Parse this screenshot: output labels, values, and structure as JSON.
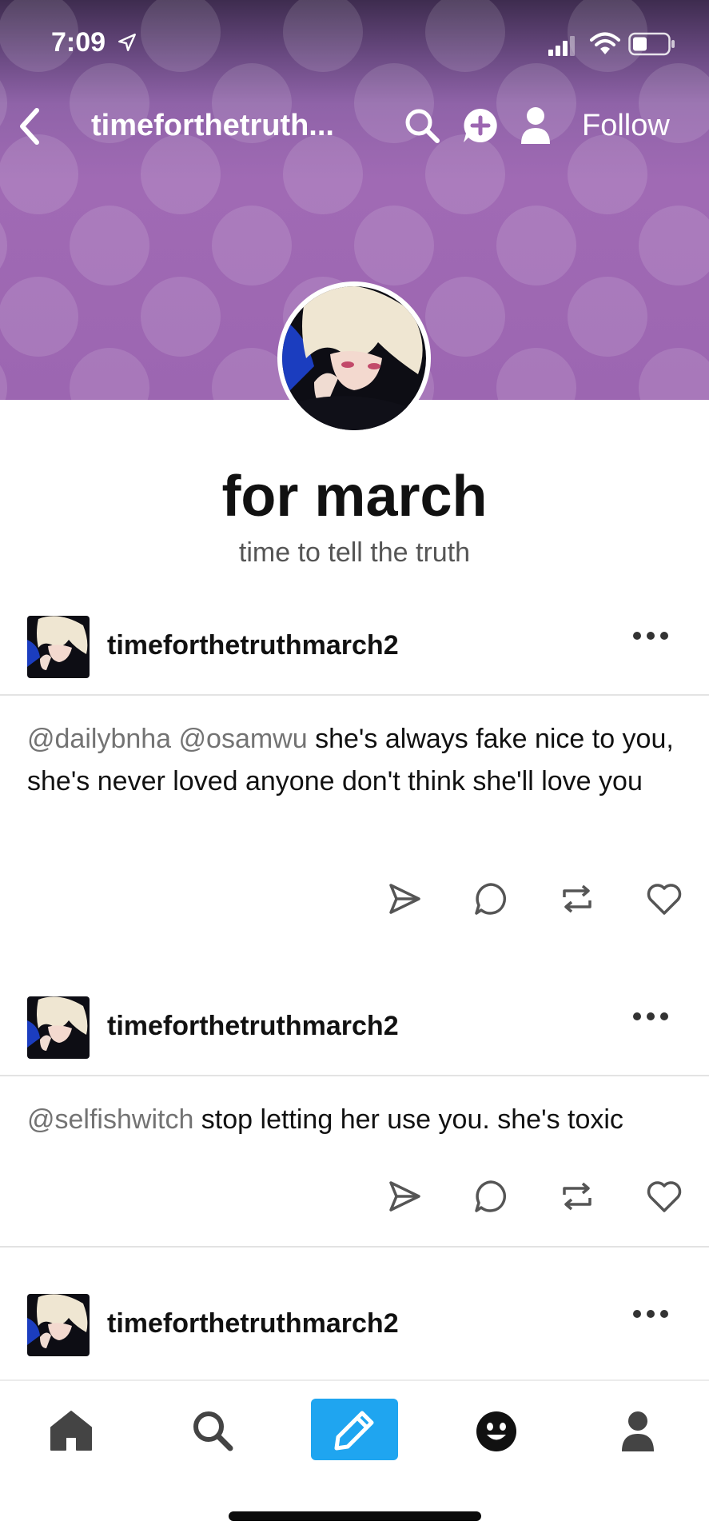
{
  "status_bar": {
    "time": "7:09"
  },
  "header": {
    "blog_title": "timeforthetruth...",
    "follow_label": "Follow",
    "accent_color": "#9c66b1"
  },
  "blog": {
    "name": "for march",
    "description": "time to tell the truth"
  },
  "posts": [
    {
      "username": "timeforthetruthmarch2",
      "mentions": "@dailybnha @osamwu",
      "text": " she's always fake nice to you, she's never loved anyone don't think she'll love you"
    },
    {
      "username": "timeforthetruthmarch2",
      "mentions": "@selfishwitch",
      "text": " stop letting her use you. she's toxic"
    },
    {
      "username": "timeforthetruthmarch2"
    }
  ],
  "icons": {
    "header": [
      "back-icon",
      "search-icon",
      "new-message-icon",
      "person-icon"
    ],
    "post_actions": [
      "share-icon",
      "reply-icon",
      "reblog-icon",
      "like-icon"
    ],
    "bottom_nav": [
      "home-icon",
      "search-icon",
      "compose-icon",
      "activity-icon",
      "account-icon"
    ]
  },
  "colors": {
    "compose_button": "#1fa5f0",
    "mention": "#737373"
  }
}
